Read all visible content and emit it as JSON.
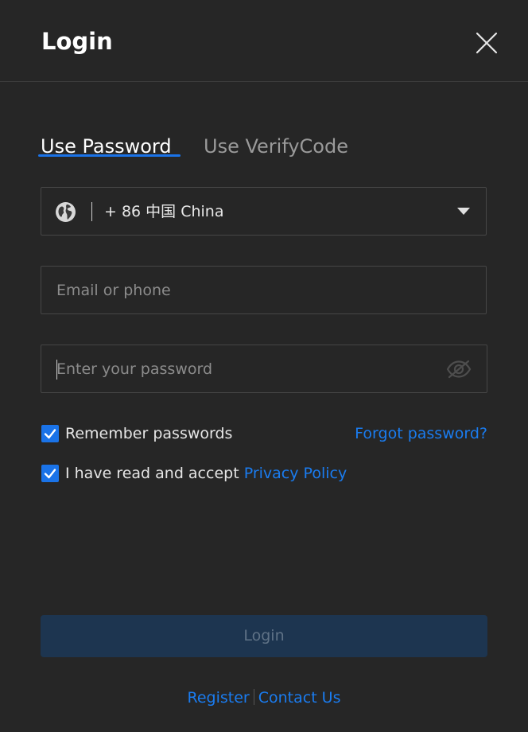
{
  "dialog": {
    "title": "Login",
    "close_icon": "close-icon"
  },
  "tabs": [
    {
      "label": "Use Password",
      "active": true
    },
    {
      "label": "Use VerifyCode",
      "active": false
    }
  ],
  "country": {
    "icon": "globe-icon",
    "value": "+ 86 中国 China",
    "dropdown_icon": "chevron-down-icon"
  },
  "email": {
    "placeholder": "Email or phone",
    "value": ""
  },
  "password": {
    "placeholder": "Enter your password",
    "value": "",
    "visibility_icon": "eye-off-icon"
  },
  "remember": {
    "label": "Remember passwords",
    "checked": true
  },
  "forgot_link": "Forgot password?",
  "privacy": {
    "prefix": "I have read and accept ",
    "link": "Privacy Policy",
    "checked": true
  },
  "login_button": "Login",
  "footer": {
    "register": "Register",
    "contact": "Contact Us"
  },
  "colors": {
    "background": "#262626",
    "accent": "#1a73e8",
    "link": "#1a7cf0",
    "button_disabled": "#1d3550"
  }
}
